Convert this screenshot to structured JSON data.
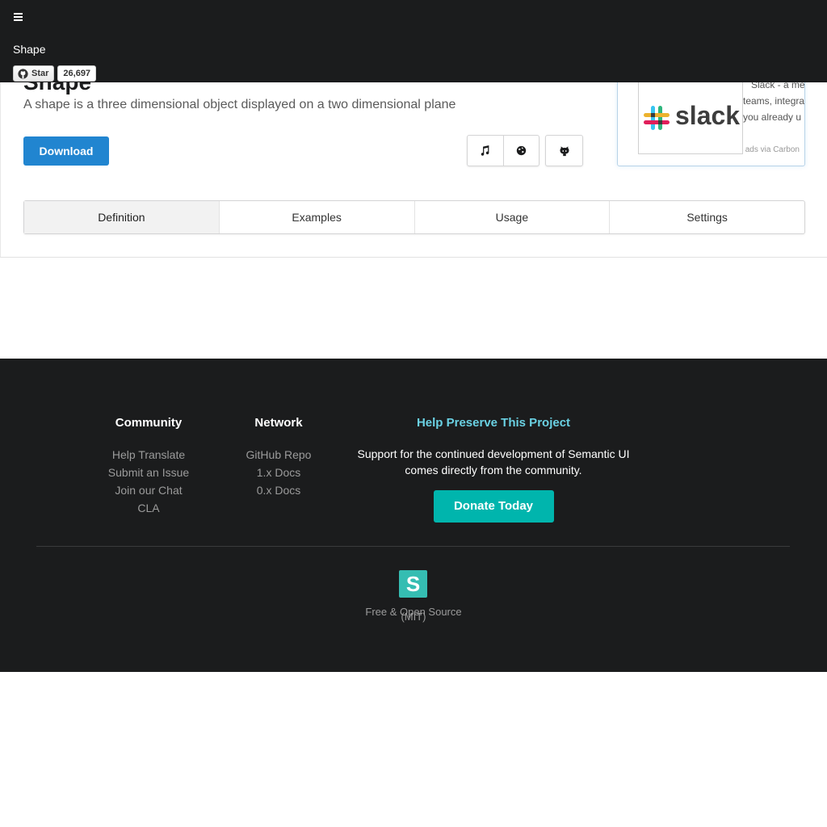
{
  "topbar": {
    "title": "Shape",
    "github": {
      "star_label": "Star",
      "star_count": "26,697"
    }
  },
  "header": {
    "title": "Shape",
    "subtitle": "A shape is a three dimensional object displayed on a two dimensional plane",
    "download_label": "Download",
    "icons": [
      "music-icon",
      "globe-icon",
      "github-icon"
    ]
  },
  "ad": {
    "brand": "slack",
    "lines": [
      "Slack - a me",
      "teams, integra",
      "you already u"
    ],
    "via": "ads via Carbon"
  },
  "tabs": [
    {
      "label": "Definition",
      "active": true
    },
    {
      "label": "Examples",
      "active": false
    },
    {
      "label": "Usage",
      "active": false
    },
    {
      "label": "Settings",
      "active": false
    }
  ],
  "footer": {
    "community": {
      "title": "Community",
      "links": [
        "Help Translate",
        "Submit an Issue",
        "Join our Chat",
        "CLA"
      ]
    },
    "network": {
      "title": "Network",
      "links": [
        "GitHub Repo",
        "1.x Docs",
        "0.x Docs"
      ]
    },
    "help": {
      "title": "Help Preserve This Project",
      "text": "Support for the continued development of Semantic UI comes directly from the community.",
      "donate_label": "Donate Today"
    },
    "logo_letter": "S",
    "license": "Free & Open Source",
    "license_type": "(MIT)"
  },
  "colors": {
    "topbar": "#1b1c1d",
    "primary": "#2185d0",
    "teal": "#00b5ad",
    "help_title": "#6ad1e3"
  }
}
